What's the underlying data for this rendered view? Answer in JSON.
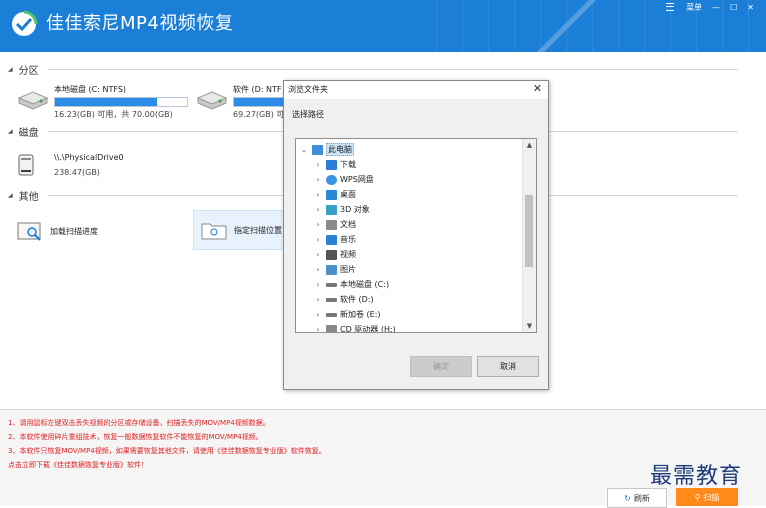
{
  "app": {
    "title": "佳佳索尼MP4视频恢复",
    "menu_label": "菜单",
    "min_glyph": "—",
    "max_glyph": "☐",
    "close_glyph": "✕"
  },
  "sections": {
    "partition": "分区",
    "disk": "磁盘",
    "other": "其他"
  },
  "partitions": [
    {
      "name": "本地磁盘 (C: NTFS)",
      "info": "16.23(GB) 可用，共 70.00(GB)",
      "used_fraction": 0.77
    },
    {
      "name": "软件 (D: NTF",
      "info": "69.27(GB) 可用",
      "used_fraction": 0.4
    }
  ],
  "disks": [
    {
      "name": "\\\\.\\PhysicalDrive0",
      "info": "238.47(GB)"
    }
  ],
  "others": [
    {
      "label": "加载扫描进度"
    },
    {
      "label": "指定扫描位置"
    }
  ],
  "notes": [
    "1、请用鼠标左键双击丢失视频的分区或存储设备，扫描丢失的MOV/MP4视频数据。",
    "2、本软件使用碎片重组技术，恢复一般数据恢复软件不能恢复的MOV/MP4视频。",
    "3、本软件只恢复MOV/MP4视频，如果需要恢复其他文件，请使用《佳佳数据恢复专业版》软件恢复。",
    "    点击立即下载《佳佳数据恢复专业版》软件！"
  ],
  "watermark": "最需教育",
  "buttons": {
    "refresh": "刷新",
    "scan": "扫描"
  },
  "dialog": {
    "title": "浏览文件夹",
    "prompt": "选择路径",
    "ok": "确定",
    "cancel": "取消",
    "tree": [
      {
        "label": "此电脑",
        "icon": "computer-icon",
        "level": 0,
        "expanded": true,
        "selected": true
      },
      {
        "label": "下载",
        "icon": "download-folder-icon",
        "level": 1
      },
      {
        "label": "WPS网盘",
        "icon": "cloud-icon",
        "level": 1
      },
      {
        "label": "桌面",
        "icon": "desktop-icon",
        "level": 1
      },
      {
        "label": "3D 对象",
        "icon": "3d-objects-icon",
        "level": 1
      },
      {
        "label": "文档",
        "icon": "documents-icon",
        "level": 1
      },
      {
        "label": "音乐",
        "icon": "music-icon",
        "level": 1
      },
      {
        "label": "视频",
        "icon": "video-icon",
        "level": 1
      },
      {
        "label": "图片",
        "icon": "pictures-icon",
        "level": 1
      },
      {
        "label": "本地磁盘 (C:)",
        "icon": "drive-icon",
        "level": 1
      },
      {
        "label": "软件 (D:)",
        "icon": "drive-icon",
        "level": 1
      },
      {
        "label": "新加卷 (E:)",
        "icon": "drive-icon",
        "level": 1
      },
      {
        "label": "CD 驱动器 (H:)",
        "icon": "cd-drive-icon",
        "level": 1
      }
    ]
  },
  "colors": {
    "brand": "#1b7fd8",
    "accent": "#ff8a1a",
    "note_red": "#e02020",
    "bar_fill": "#2b8be6"
  }
}
